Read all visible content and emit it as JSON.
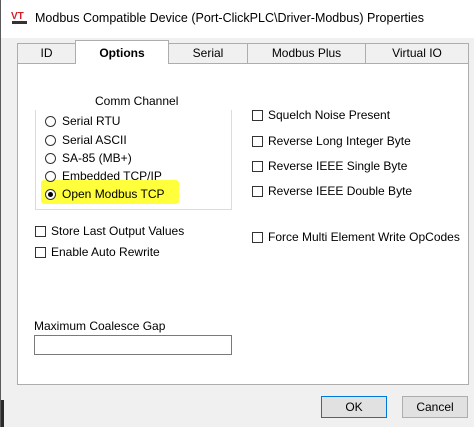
{
  "window": {
    "title": "Modbus Compatible Device (Port-ClickPLC\\Driver-Modbus) Properties",
    "icon": "vt-app-icon",
    "colors": {
      "icon_red": "#d21f26",
      "icon_dark": "#333333",
      "highlight": "#ffff3c"
    }
  },
  "tabs": [
    {
      "label": "ID",
      "active": false
    },
    {
      "label": "Options",
      "active": true
    },
    {
      "label": "Serial",
      "active": false
    },
    {
      "label": "Modbus Plus",
      "active": false
    },
    {
      "label": "Virtual IO",
      "active": false
    }
  ],
  "comm_channel": {
    "label": "Comm Channel",
    "options": [
      {
        "label": "Serial RTU",
        "selected": false
      },
      {
        "label": "Serial ASCII",
        "selected": false
      },
      {
        "label": "SA-85 (MB+)",
        "selected": false
      },
      {
        "label": "Embedded TCP/IP",
        "selected": false
      },
      {
        "label": "Open Modbus TCP",
        "selected": true
      }
    ]
  },
  "left_checks": [
    {
      "label": "Store Last Output Values",
      "checked": false
    },
    {
      "label": "Enable Auto Rewrite",
      "checked": false
    }
  ],
  "right_checks": [
    {
      "label": "Squelch Noise Present",
      "checked": false
    },
    {
      "label": "Reverse Long Integer Byte",
      "checked": false
    },
    {
      "label": "Reverse IEEE Single Byte",
      "checked": false
    },
    {
      "label": "Reverse IEEE Double Byte",
      "checked": false
    },
    {
      "label": "Force Multi Element Write OpCodes",
      "checked": false
    }
  ],
  "coalesce": {
    "label": "Maximum Coalesce Gap",
    "value": ""
  },
  "buttons": {
    "ok": "OK",
    "cancel": "Cancel"
  }
}
